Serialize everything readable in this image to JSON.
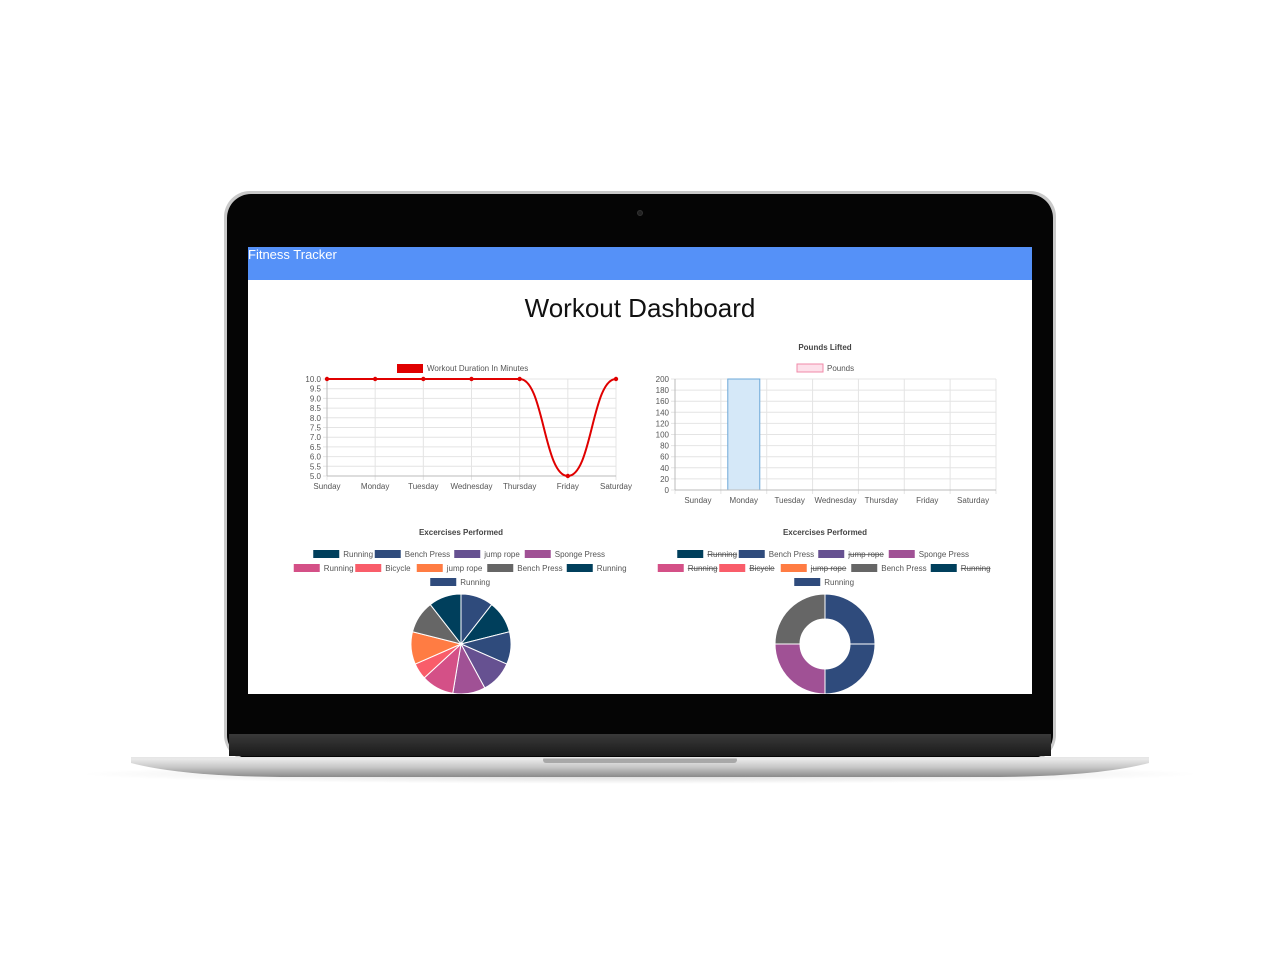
{
  "navbar": {
    "brand": "Fitness Tracker"
  },
  "page": {
    "title": "Workout Dashboard"
  },
  "colors": {
    "navbar": "#5591f8",
    "line": "#e00000",
    "bar_fill": "#d5e8f8",
    "bar_stroke": "#6ca8d8",
    "palette": [
      "#003f5c",
      "#2f4b7c",
      "#665191",
      "#a05195",
      "#d45087",
      "#f95d6a",
      "#ff7c43",
      "#666666",
      "#003f5c",
      "#2f4b7c"
    ]
  },
  "chart_data": [
    {
      "type": "line",
      "title": "",
      "legend": [
        "Workout Duration In Minutes"
      ],
      "legend_position": "top",
      "categories": [
        "Sunday",
        "Monday",
        "Tuesday",
        "Wednesday",
        "Thursday",
        "Friday",
        "Saturday"
      ],
      "series": [
        {
          "name": "Workout Duration In Minutes",
          "values": [
            10,
            10,
            10,
            10,
            10,
            5,
            10
          ]
        }
      ],
      "ylim": [
        5,
        10
      ],
      "yticks": [
        "10.0",
        "9.5",
        "9.0",
        "8.5",
        "8.0",
        "7.5",
        "7.0",
        "6.5",
        "6.0",
        "5.5",
        "5.0"
      ],
      "grid": true
    },
    {
      "type": "bar",
      "title": "Pounds Lifted",
      "legend": [
        "Pounds"
      ],
      "legend_position": "top",
      "categories": [
        "Sunday",
        "Monday",
        "Tuesday",
        "Wednesday",
        "Thursday",
        "Friday",
        "Saturday"
      ],
      "series": [
        {
          "name": "Pounds",
          "values": [
            0,
            200,
            0,
            0,
            0,
            0,
            0
          ]
        }
      ],
      "ylim": [
        0,
        200
      ],
      "yticks": [
        "200",
        "180",
        "160",
        "140",
        "120",
        "100",
        "80",
        "60",
        "40",
        "20",
        "0"
      ],
      "grid": true
    },
    {
      "type": "pie",
      "title": "Excercises Performed",
      "legend_position": "top",
      "labels": [
        "Running",
        "Bench Press",
        "jump rope",
        "Sponge Press",
        "Running",
        "Bicycle",
        "jump rope",
        "Bench Press",
        "Running",
        "Running"
      ],
      "values": [
        1,
        1,
        1,
        1,
        1,
        0.5,
        1,
        1,
        1,
        1
      ]
    },
    {
      "type": "pie",
      "subtype": "doughnut",
      "title": "Excercises Performed",
      "legend_position": "top",
      "labels": [
        "Running",
        "Bench Press",
        "jump rope",
        "Sponge Press",
        "Running",
        "Bicycle",
        "jump rope",
        "Bench Press",
        "Running",
        "Running"
      ],
      "hidden": [
        true,
        false,
        true,
        false,
        true,
        true,
        true,
        false,
        true,
        false
      ],
      "values": [
        1,
        1,
        1,
        1,
        1,
        1,
        1,
        1,
        1,
        1
      ]
    }
  ]
}
